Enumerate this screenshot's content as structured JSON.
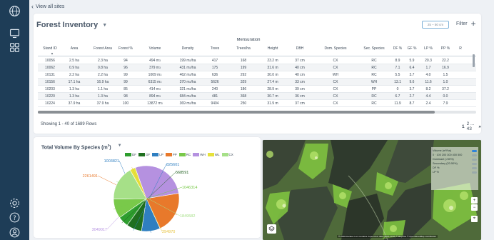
{
  "nav": {
    "back_label": "View all sites"
  },
  "header": {
    "title": "Forest Inventory",
    "unit_box": "25 – 50 cm",
    "filter_label": "Filter"
  },
  "table": {
    "group_label": "Mensuration",
    "columns": [
      "Stand ID",
      "Area",
      "Forest Area",
      "Forest %",
      "Volume",
      "Density",
      "Trees",
      "Trees/ha",
      "Height",
      "DBH",
      "Dom. Species",
      "Sec. Species",
      "DF %",
      "GF %",
      "LP %",
      "PP %",
      "R"
    ],
    "rows": [
      [
        "10056",
        "2.5 ha",
        "2.3 ha",
        "94",
        "494 m³",
        "199 m³/ha",
        "417",
        "168",
        "23.2 m",
        "37 cm",
        "CX",
        "RC",
        "8.9",
        "5.9",
        "20.3",
        "22.2"
      ],
      [
        "10062",
        "0.9 ha",
        "0.8 ha",
        "96",
        "379 m³",
        "431 m³/ha",
        "175",
        "199",
        "31.6 m",
        "40 cm",
        "CX",
        "RC",
        "7.1",
        "6.4",
        "1.7",
        "16.9"
      ],
      [
        "10131",
        "2.2 ha",
        "2.2 ha",
        "99",
        "1009 m³",
        "462 m³/ha",
        "636",
        "292",
        "30.0 m",
        "40 cm",
        "WH",
        "RC",
        "5.5",
        "3.7",
        "4.0",
        "1.5"
      ],
      [
        "10156",
        "17.1 ha",
        "16.9 ha",
        "99",
        "6315 m³",
        "370 m³/ha",
        "5626",
        "329",
        "27.4 m",
        "33 cm",
        "CX",
        "WH",
        "13.1",
        "9.6",
        "11.6",
        "1.0"
      ],
      [
        "10203",
        "1.3 ha",
        "1.1 ha",
        "85",
        "414 m³",
        "321 m³/ha",
        "240",
        "186",
        "28.9 m",
        "39 cm",
        "CX",
        "PP",
        "0",
        "3.7",
        "8.2",
        "37.2"
      ],
      [
        "10220",
        "1.3 ha",
        "1.3 ha",
        "98",
        "894 m³",
        "684 m³/ha",
        "481",
        "368",
        "30.7 m",
        "36 cm",
        "CX",
        "RC",
        "6.7",
        "2.7",
        "4.4",
        "0.0"
      ],
      [
        "10224",
        "37.9 ha",
        "37.9 ha",
        "100",
        "13872 m³",
        "369 m³/ha",
        "9404",
        "250",
        "31.9 m",
        "37 cm",
        "CX",
        "RC",
        "11.9",
        "8.7",
        "2.4",
        "7.9"
      ]
    ],
    "showing": "Showing 1 - 40 of 1689 Rows",
    "pager_current": "1",
    "pager_rest": "2 ... 43",
    "pager_next": "»"
  },
  "chart": {
    "title": "Total Volume By Species (m",
    "title_sup": "3",
    "title_close": ")"
  },
  "chart_data": {
    "type": "pie",
    "title": "Total Volume By Species (m3)",
    "legend": [
      "DF",
      "GF",
      "LP",
      "PP",
      "RC",
      "WH",
      "WL",
      "CX"
    ],
    "legend_placement": "top",
    "slices": [
      {
        "name": "DF",
        "value": 568591,
        "color": "#2e9e2e"
      },
      {
        "name": "GF",
        "value": 825601,
        "color": "#1f6f1f"
      },
      {
        "name": "LP",
        "value": 1003821,
        "color": "#2f7fc1"
      },
      {
        "name": "PP",
        "value": 2261491,
        "color": "#e8792b"
      },
      {
        "name": "RC",
        "value": 1046314,
        "color": "#79c94a"
      },
      {
        "name": "WH",
        "value": 3049017,
        "color": "#b591e0"
      },
      {
        "name": "WL",
        "value": 294970,
        "color": "#e6e23b"
      },
      {
        "name": "CX",
        "value": 1849582,
        "color": "#a6e088"
      }
    ],
    "data_labels": [
      {
        "text": "1003821",
        "color": "#2f7fc1"
      },
      {
        "text": "825601",
        "color": "#2f7fc1"
      },
      {
        "text": "568591",
        "color": "#1f5f1f"
      },
      {
        "text": "1046314",
        "color": "#79c94a"
      },
      {
        "text": "1849582",
        "color": "#a6e088"
      },
      {
        "text": "294970",
        "color": "#e6c23b"
      },
      {
        "text": "3049017",
        "color": "#b591e0"
      },
      {
        "text": "2261491",
        "color": "#e8792b"
      }
    ]
  },
  "map": {
    "layers": [
      {
        "label": "Volume (m³/ha)",
        "on": true
      },
      {
        "label": "0 · 100 200 300 400 500",
        "on": false
      },
      {
        "label": "Dominant (>50%)",
        "on": false
      },
      {
        "label": "Secondary (20-50%)",
        "on": false
      },
      {
        "label": "DF %",
        "on": false
      },
      {
        "label": "LP %",
        "on": false
      }
    ],
    "attribution": "© 2020 Rezatec Ltd. Contains Copernicus data (2015-2018) © MapTiler © OpenStreetMap contributors"
  },
  "icons": [
    "globe-icon",
    "monitor-icon",
    "grid-icon",
    "settings-icon",
    "help-icon",
    "user-icon",
    "layers-icon"
  ]
}
